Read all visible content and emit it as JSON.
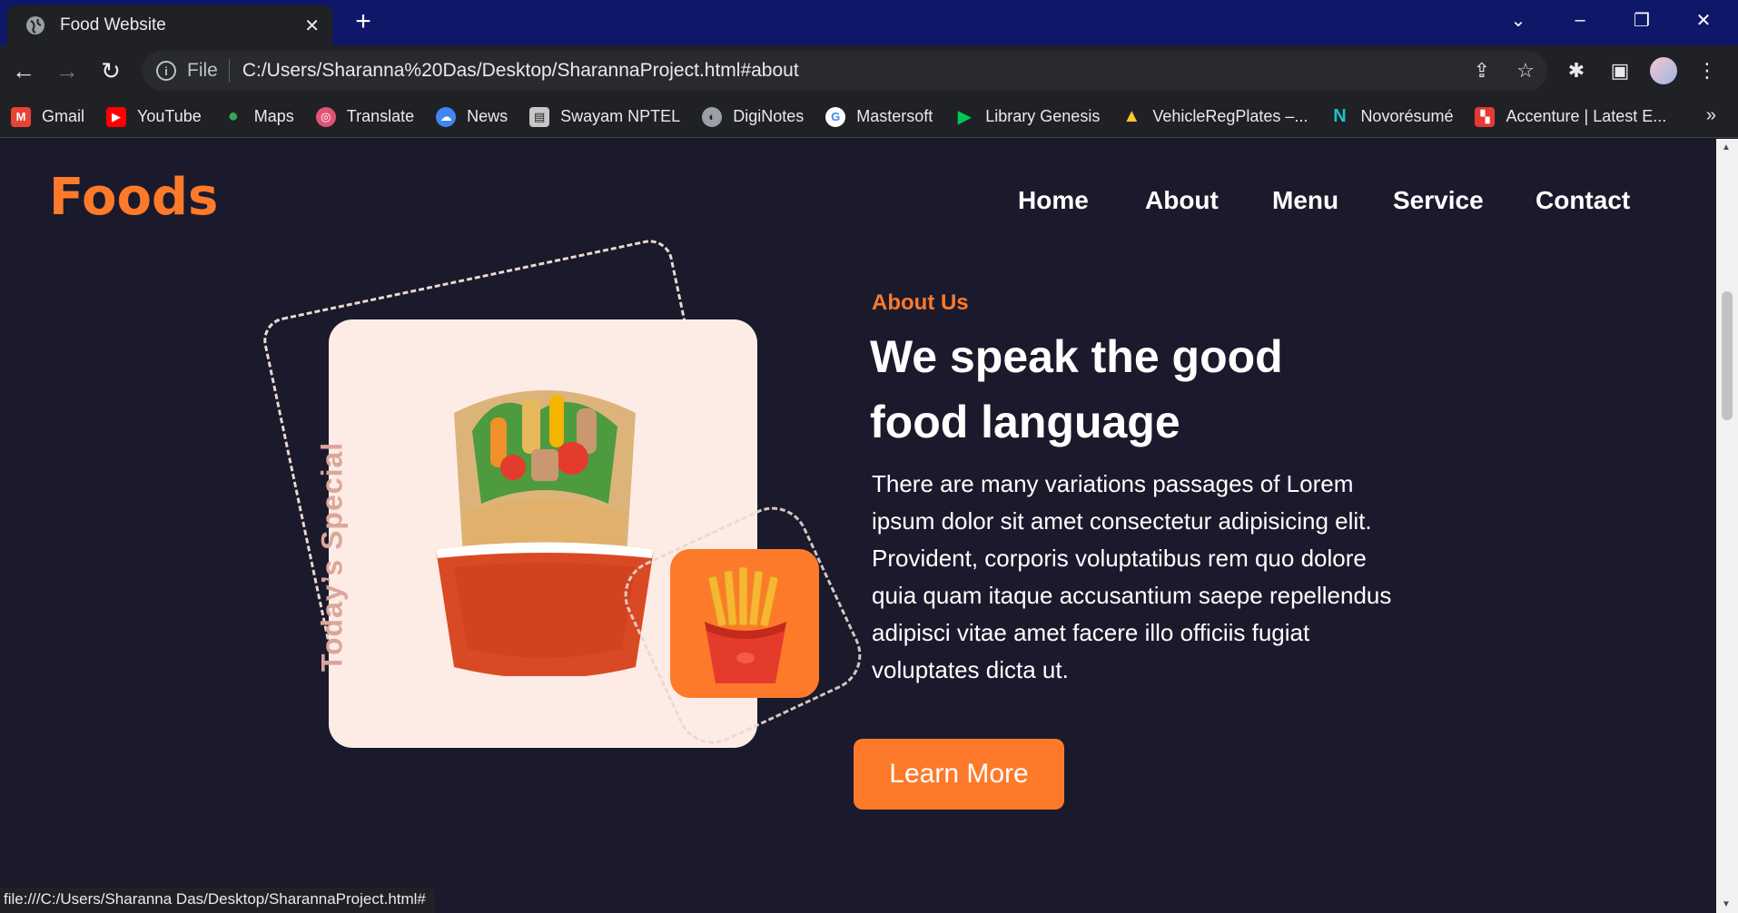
{
  "browser": {
    "tab_title": "Food Website",
    "address_prefix": "File",
    "url": "C:/Users/Sharanna%20Das/Desktop/SharannaProject.html#about",
    "status_url": "file:///C:/Users/Sharanna Das/Desktop/SharannaProject.html#",
    "bookmarks": [
      {
        "label": "Gmail",
        "icon": "gmail-icon",
        "color": "#ea4335"
      },
      {
        "label": "YouTube",
        "icon": "youtube-icon",
        "color": "#ff0000"
      },
      {
        "label": "Maps",
        "icon": "maps-icon",
        "color": "#34a853"
      },
      {
        "label": "Translate",
        "icon": "translate-icon",
        "color": "#e05575"
      },
      {
        "label": "News",
        "icon": "news-icon",
        "color": "#4285f4"
      },
      {
        "label": "Swayam NPTEL",
        "icon": "swayam-icon",
        "color": "#c7c7c7"
      },
      {
        "label": "DigiNotes",
        "icon": "globe-icon",
        "color": "#9aa0a6"
      },
      {
        "label": "Mastersoft",
        "icon": "google-icon",
        "color": "#ffffff"
      },
      {
        "label": "Library Genesis",
        "icon": "play-icon",
        "color": "#00c853"
      },
      {
        "label": "VehicleRegPlates –...",
        "icon": "firebase-icon",
        "color": "#ffca28"
      },
      {
        "label": "Novorésumé",
        "icon": "novoresume-icon",
        "color": "#18c4c7"
      },
      {
        "label": "Accenture | Latest E...",
        "icon": "accenture-icon",
        "color": "#e53935"
      }
    ]
  },
  "site": {
    "logo": "Foods",
    "nav": [
      "Home",
      "About",
      "Menu",
      "Service",
      "Contact"
    ],
    "card_label": "Today’s Special",
    "about_eyebrow": "About Us",
    "headline_line1": "We speak the good",
    "headline_line2": "food language",
    "paragraph": "There are many variations passages of Lorem ipsum dolor sit amet consectetur adipisicing elit. Provident, corporis voluptatibus rem quo dolore quia quam itaque accusantium saepe repellendus adipisci vitae amet facere illo officiis fugiat voluptates dicta ut.",
    "cta": "Learn More"
  },
  "colors": {
    "accent": "#fd7a2a",
    "background": "#1b1a2c",
    "card": "#fdece6"
  }
}
